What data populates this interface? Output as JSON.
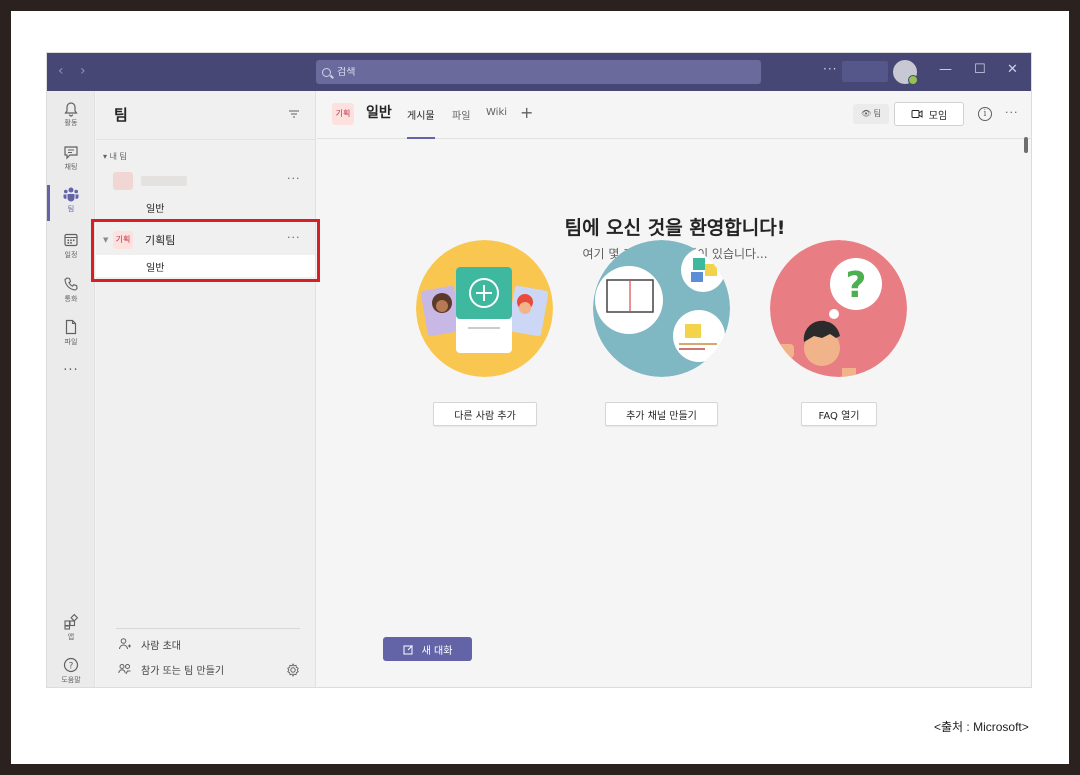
{
  "titlebar": {
    "search_placeholder": "검색"
  },
  "rail": [
    {
      "label": "활동",
      "icon": "bell-icon"
    },
    {
      "label": "채팅",
      "icon": "chat-icon"
    },
    {
      "label": "팀",
      "icon": "teams-icon"
    },
    {
      "label": "일정",
      "icon": "calendar-icon"
    },
    {
      "label": "통화",
      "icon": "phone-icon"
    },
    {
      "label": "파일",
      "icon": "file-icon"
    },
    {
      "label": "앱",
      "icon": "apps-icon"
    },
    {
      "label": "도움말",
      "icon": "help-icon"
    }
  ],
  "teams_panel": {
    "title": "팀",
    "section": "내 팀",
    "team_avatar": "기획",
    "team_name": "기획팀",
    "channel_general": "일반",
    "invite": "사람 초대",
    "join_create": "참가 또는 팀 만들기"
  },
  "channel": {
    "avatar": "기획",
    "name": "일반",
    "tabs": [
      "게시물",
      "파일",
      "Wiki"
    ],
    "team_pill": "팀",
    "meet_label": "모임"
  },
  "welcome": {
    "title": "팀에 오신 것을 환영합니다!",
    "subtitle": "여기 몇 가지 시작할 것이 있습니다...",
    "actions": [
      "다른 사람 추가",
      "추가 채널 만들기",
      "FAQ 열기"
    ],
    "new_conversation": "새 대화"
  },
  "caption": "<출처 : Microsoft>",
  "colors": {
    "titlebar": "#464775",
    "accent": "#6264a7",
    "highlight_box": "#d81f26"
  }
}
